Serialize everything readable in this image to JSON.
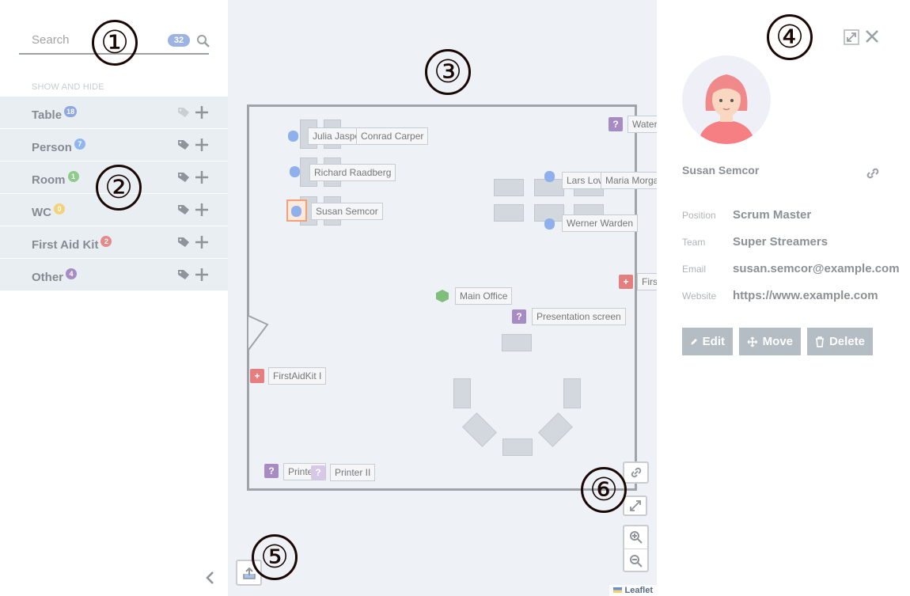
{
  "search": {
    "placeholder": "Search",
    "count": "32"
  },
  "sidebar": {
    "heading": "SHOW AND HIDE",
    "categories": [
      {
        "label": "Table",
        "count": "18",
        "color": "#8fa8e0"
      },
      {
        "label": "Person",
        "count": "7",
        "color": "#8fb6f0"
      },
      {
        "label": "Room",
        "count": "1",
        "color": "#8fcb8a"
      },
      {
        "label": "WC",
        "count": "0",
        "color": "#f4d27a"
      },
      {
        "label": "First Aid Kit",
        "count": "2",
        "color": "#e58a8a"
      },
      {
        "label": "Other",
        "count": "4",
        "color": "#a68cc3"
      }
    ]
  },
  "map": {
    "labels": {
      "julia": "Julia Jaspo",
      "conrad": "Conrad Carper",
      "richard": "Richard Raadberg",
      "susan": "Susan Semcor",
      "lars": "Lars Low",
      "maria": "Maria Morga",
      "werner": "Werner Warden",
      "water": "Water",
      "first": "First",
      "main_office": "Main Office",
      "presentation": "Presentation screen",
      "firstaid1": "FirstAidKit I",
      "printer1": "Printer I",
      "printer2": "Printer II"
    },
    "attribution": "Leaflet"
  },
  "panel": {
    "name": "Susan Semcor",
    "fields": [
      {
        "key": "Position",
        "value": "Scrum Master"
      },
      {
        "key": "Team",
        "value": "Super Streamers"
      },
      {
        "key": "Email",
        "value": "susan.semcor@example.com"
      },
      {
        "key": "Website",
        "value": "https://www.example.com"
      }
    ],
    "buttons": {
      "edit": "Edit",
      "move": "Move",
      "delete": "Delete"
    }
  },
  "callouts": [
    "①",
    "②",
    "③",
    "④",
    "⑤",
    "⑥"
  ],
  "colors": {
    "other": "#a68cc3",
    "first_aid": "#e57e7e",
    "room": "#7fbf7b",
    "selection": "#f2a27a"
  },
  "icons": [
    "search-icon",
    "tag-icon",
    "plus-icon",
    "chevron-left-icon",
    "link-icon",
    "expand-icon",
    "close-icon",
    "pencil-icon",
    "move-icon",
    "trash-icon",
    "zoom-in-icon",
    "zoom-out-icon",
    "fullscreen-icon",
    "upload-icon"
  ]
}
